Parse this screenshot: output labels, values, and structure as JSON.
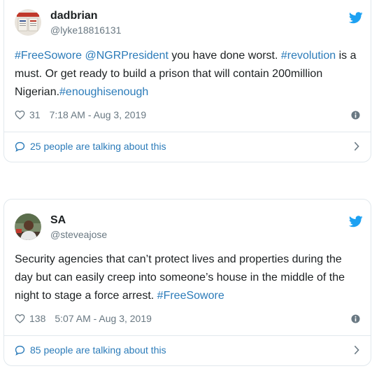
{
  "tweets": [
    {
      "name": "dadbrian",
      "handle": "@lyke18816131",
      "text": [
        {
          "t": "#FreeSowore",
          "link": true
        },
        {
          "t": " ",
          "link": false
        },
        {
          "t": "@NGRPresident",
          "link": true
        },
        {
          "t": " you have done worst. ",
          "link": false
        },
        {
          "t": "#revolution",
          "link": true
        },
        {
          "t": " is a must. Or get ready to build a prison that will contain 200million Nigerian.",
          "link": false
        },
        {
          "t": "#enoughisenough",
          "link": true
        }
      ],
      "likes": "31",
      "timestamp": "7:18 AM - Aug 3, 2019",
      "talking": "25 people are talking about this"
    },
    {
      "name": "SA",
      "handle": "@steveajose",
      "text": [
        {
          "t": "Security agencies that can’t protect lives and properties during the day but can easily creep into someone’s house in the middle of the night to stage a force arrest. ",
          "link": false
        },
        {
          "t": "#FreeSowore",
          "link": true
        }
      ],
      "likes": "138",
      "timestamp": "5:07 AM - Aug 3, 2019",
      "talking": "85 people are talking about this"
    }
  ],
  "icons": {
    "brand": "twitter-bird-icon",
    "like": "heart-icon",
    "info": "info-icon",
    "talk": "speech-bubble-icon",
    "more": "chevron-right-icon"
  },
  "colors": {
    "link": "#2b7bb9",
    "twitter_blue": "#1da1f2",
    "muted": "#697882",
    "border": "#e1e8ed"
  }
}
